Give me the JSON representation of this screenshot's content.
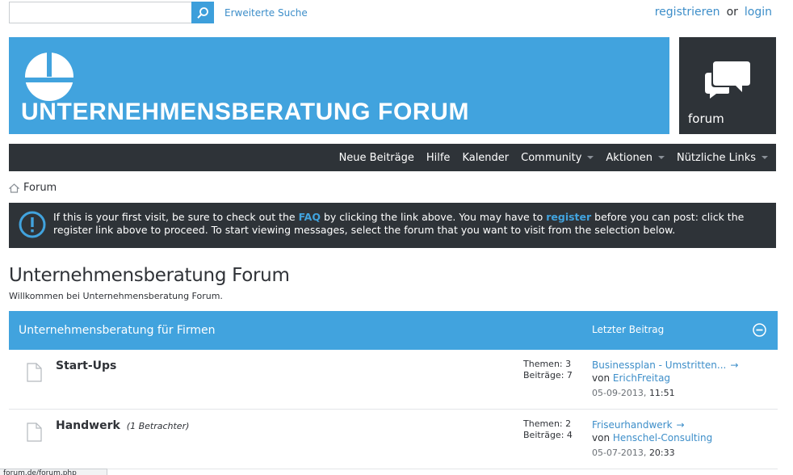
{
  "header": {
    "search_placeholder": "",
    "advanced_search": "Erweiterte Suche",
    "register": "registrieren",
    "or": "or",
    "login": "login"
  },
  "banner": {
    "title": "UNTERNEHMENSBERATUNG FORUM",
    "forum_label": "forum"
  },
  "nav": {
    "items": [
      {
        "label": "Neue Beiträge",
        "dropdown": false
      },
      {
        "label": "Hilfe",
        "dropdown": false
      },
      {
        "label": "Kalender",
        "dropdown": false
      },
      {
        "label": "Community",
        "dropdown": true
      },
      {
        "label": "Aktionen",
        "dropdown": true
      },
      {
        "label": "Nützliche Links",
        "dropdown": true
      }
    ]
  },
  "breadcrumb": {
    "label": "Forum"
  },
  "notice": {
    "part1": "If this is your first visit, be sure to check out the ",
    "faq": "FAQ",
    "part2": " by clicking the link above. You may have to ",
    "register": "register",
    "part3": " before you can post: click the register link above to proceed. To start viewing messages, select the forum that you want to visit from the selection below."
  },
  "page": {
    "title": "Unternehmensberatung Forum",
    "description": "Willkommen bei Unternehmensberatung Forum."
  },
  "category": {
    "title": "Unternehmensberatung für Firmen",
    "last_post_header": "Letzter Beitrag"
  },
  "forums": [
    {
      "name": "Start-Ups",
      "viewers": "",
      "topics": "Themen: 3",
      "posts": "Beiträge: 7",
      "last_title": "Businessplan - Umstritten...",
      "by": "von",
      "author": "ErichFreitag",
      "date": "05-09-2013,",
      "time": "11:51"
    },
    {
      "name": "Handwerk",
      "viewers": "(1 Betrachter)",
      "topics": "Themen: 2",
      "posts": "Beiträge: 4",
      "last_title": "Friseurhandwerk",
      "by": "von",
      "author": "Henschel-Consulting",
      "date": "05-07-2013,",
      "time": "20:33"
    }
  ],
  "status_bar": {
    "text": "forum.de/forum.php"
  },
  "colors": {
    "accent": "#41a3de",
    "dark": "#2e3338",
    "link": "#3d8ec9"
  }
}
